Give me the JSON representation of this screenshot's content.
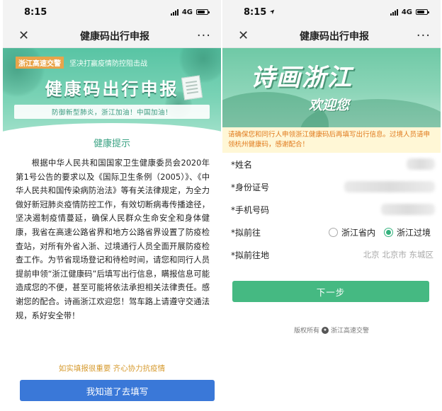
{
  "left": {
    "status": {
      "time": "8:15",
      "network": "4G"
    },
    "nav": {
      "close": "✕",
      "title": "健康码出行申报",
      "more": "···"
    },
    "banner": {
      "tag": "浙江高速交警",
      "slogan": "坚决打赢疫情防控阻击战",
      "title": "健康码出行申报",
      "subtitle": "防御新型肺炎，浙江加油！中国加油！"
    },
    "notice": {
      "heading": "健康提示",
      "body": "根据中华人民共和国国家卫生健康委员会2020年第1号公告的要求以及《国际卫生条例（2005）》、《中华人民共和国传染病防治法》等有关法律规定，为全力做好新冠肺炎疫情防控工作，有效切断病毒传播途径，坚决遏制疫情蔓延，确保人民群众生命安全和身体健康，我省在高速公路省界和地方公路省界设置了防疫检查站，对所有外省入浙、过境通行人员全面开展防疫检查工作。为节省现场登记和待检时间，请您和同行人员提前申领“浙江健康码”后填写出行信息，瞒报信息可能造成您的不便，甚至可能将依法承担相关法律责任。感谢您的配合。诗画浙江欢迎您！驾车路上请遵守交通法规，系好安全带！"
    },
    "tip": "如实填报很重要 齐心协力抗疫情",
    "confirm_button": "我知道了去填写"
  },
  "right": {
    "status": {
      "time": "8:15",
      "network": "4G"
    },
    "nav": {
      "close": "✕",
      "title": "健康码出行申报",
      "more": "···"
    },
    "banner": {
      "title": "诗画浙江",
      "subtitle": "欢迎您"
    },
    "warning": "请确保您和同行人申领浙江健康码后再填写出行信息。过境人员请申领杭州健康码，感谢配合！",
    "form": {
      "name_label": "*姓名",
      "id_label": "*身份证号",
      "phone_label": "*手机号码",
      "destination_label": "*拟前往",
      "option_inside": "浙江省内",
      "option_transit": "浙江过境",
      "region_label": "*拟前往地",
      "region_value": "北京 北京市 东城区"
    },
    "next_button": "下一步",
    "copyright": "版权所有",
    "copyright_org": "浙江高速交警"
  }
}
